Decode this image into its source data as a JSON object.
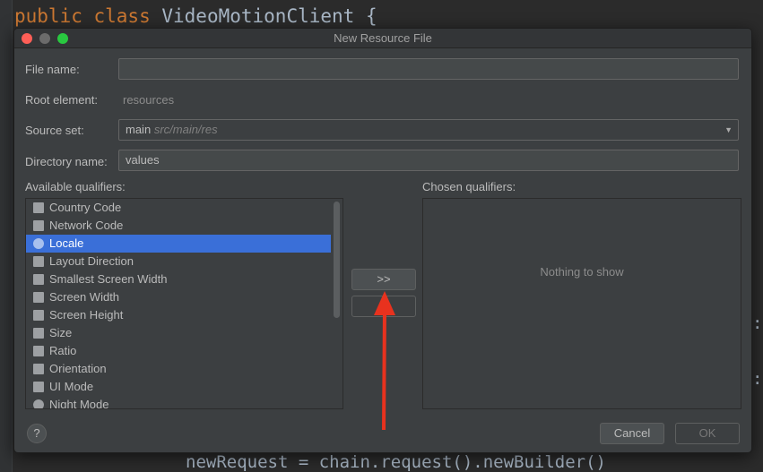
{
  "editor": {
    "line_top_kw": "public class",
    "line_top_name": "VideoMotionClient {",
    "line_bottom": "newRequest = chain.request().newBuilder()",
    "frag1": ":c",
    "frag2": ":x"
  },
  "dialog": {
    "title": "New Resource File",
    "file_name": {
      "label": "File name:",
      "value": ""
    },
    "root_element": {
      "label": "Root element:",
      "value": "resources"
    },
    "source_set": {
      "label": "Source set:",
      "value": "main",
      "hint": "src/main/res"
    },
    "directory_name": {
      "label": "Directory name:",
      "value": "values"
    },
    "available_label": "Available qualifiers:",
    "chosen_label": "Chosen qualifiers:",
    "qualifiers": [
      {
        "label": "Country Code",
        "icon": "country-code-icon"
      },
      {
        "label": "Network Code",
        "icon": "network-code-icon"
      },
      {
        "label": "Locale",
        "icon": "globe-icon",
        "selected": true
      },
      {
        "label": "Layout Direction",
        "icon": "layout-direction-icon"
      },
      {
        "label": "Smallest Screen Width",
        "icon": "smallest-width-icon"
      },
      {
        "label": "Screen Width",
        "icon": "screen-width-icon"
      },
      {
        "label": "Screen Height",
        "icon": "screen-height-icon"
      },
      {
        "label": "Size",
        "icon": "size-icon"
      },
      {
        "label": "Ratio",
        "icon": "ratio-icon"
      },
      {
        "label": "Orientation",
        "icon": "orientation-icon"
      },
      {
        "label": "UI Mode",
        "icon": "ui-mode-icon"
      },
      {
        "label": "Night Mode",
        "icon": "night-mode-icon"
      }
    ],
    "add_button": ">>",
    "remove_button": "",
    "empty_text": "Nothing to show",
    "help": "?",
    "cancel": "Cancel",
    "ok": "OK"
  },
  "colors": {
    "selection": "#3a6fd8",
    "annotation_arrow": "#e8321e"
  }
}
